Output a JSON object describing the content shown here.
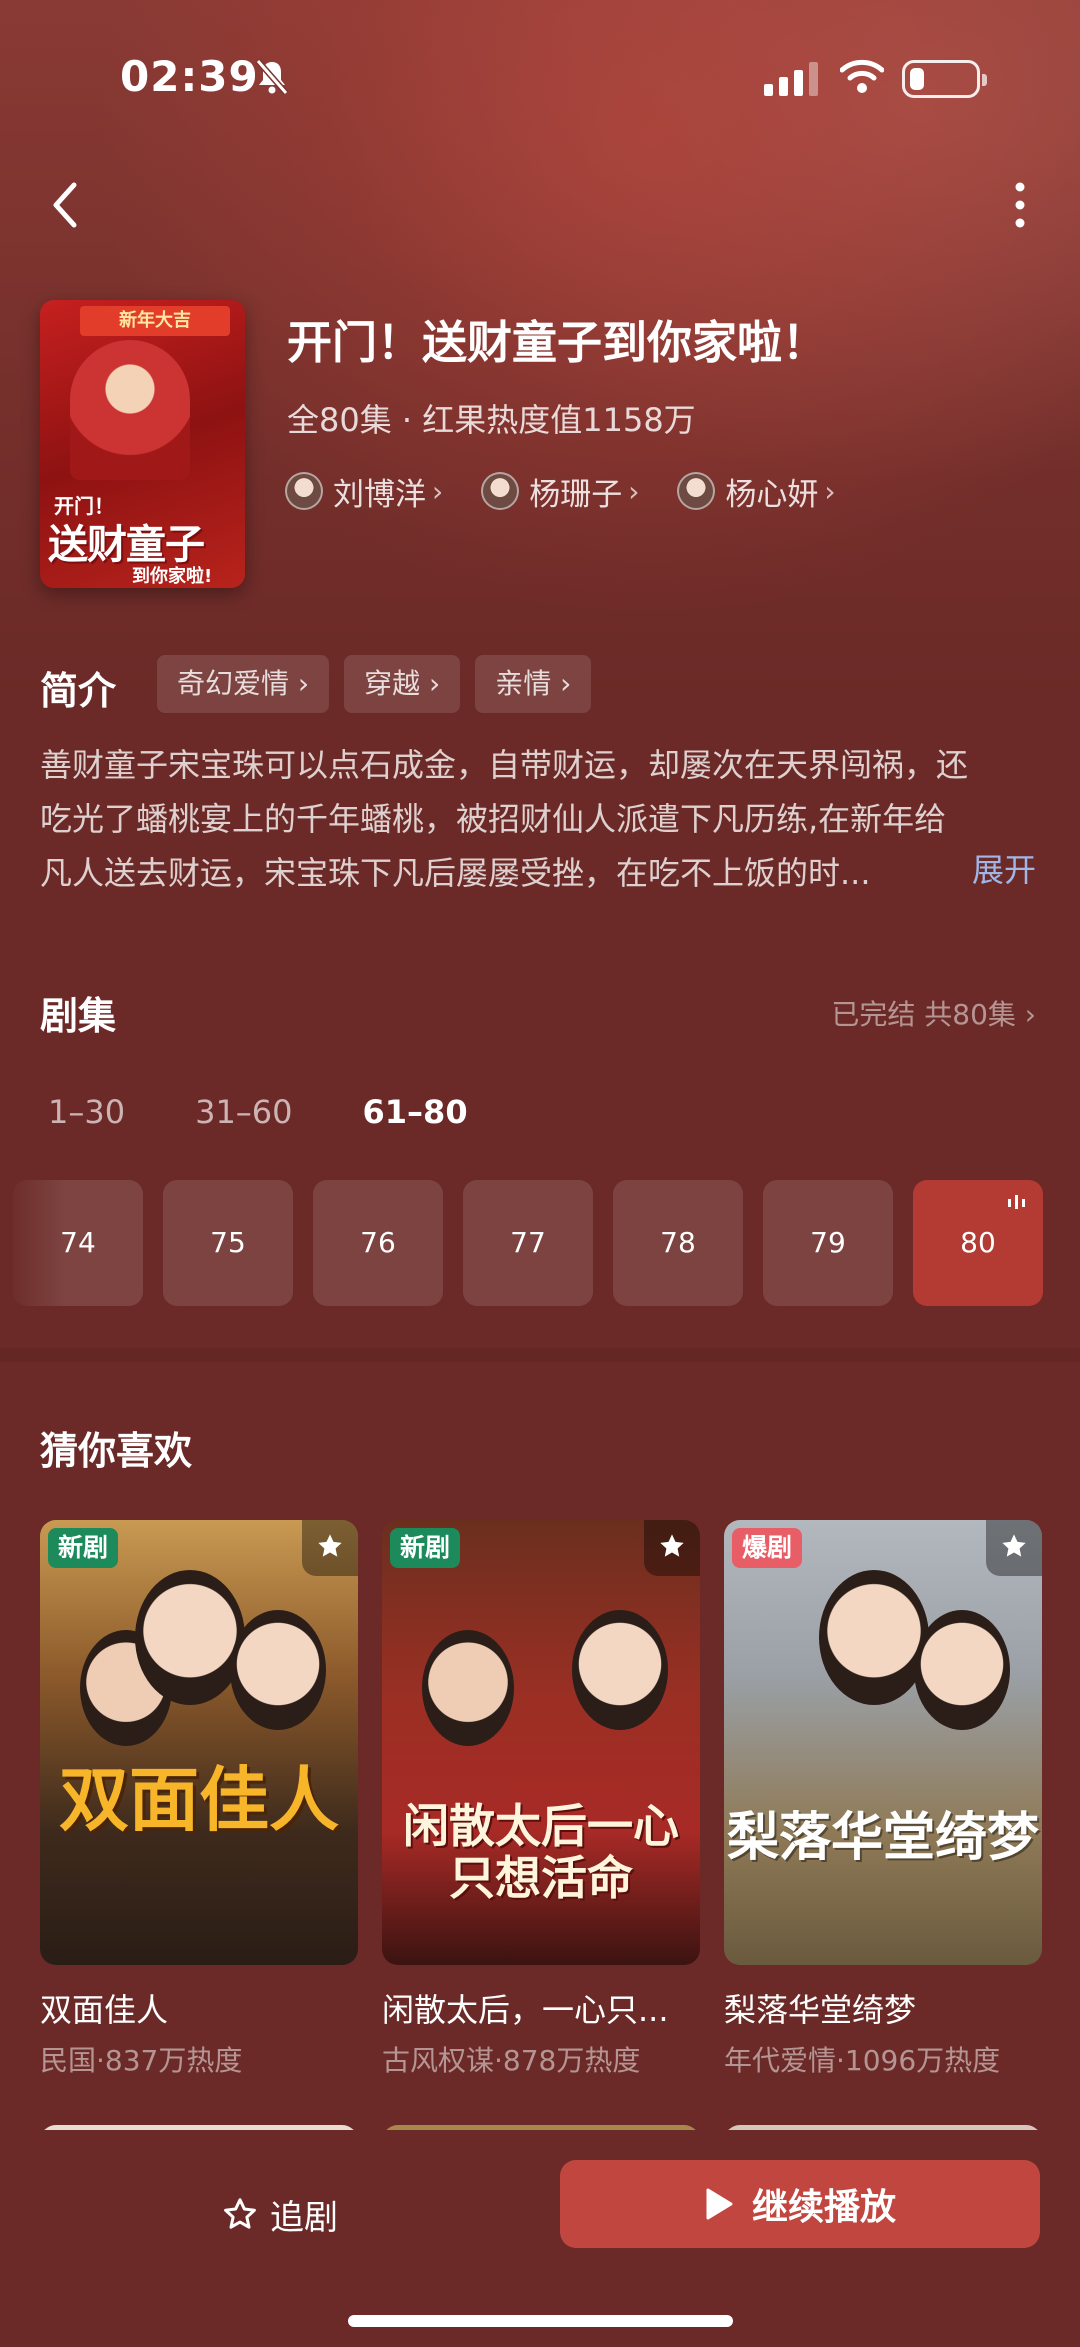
{
  "status_bar": {
    "time": "02:39"
  },
  "show": {
    "title": "开门！送财童子到你家啦！",
    "meta": "全80集 · 红果热度值1158万",
    "poster": {
      "banner": "新年大吉",
      "line1": "开门！",
      "line2": "送财童子",
      "line3": "到你家啦!"
    },
    "cast": [
      {
        "name": "刘博洋"
      },
      {
        "name": "杨珊子"
      },
      {
        "name": "杨心妍"
      }
    ]
  },
  "intro": {
    "heading": "简介",
    "tags": [
      "奇幻爱情",
      "穿越",
      "亲情"
    ],
    "lines": [
      "善财童子宋宝珠可以点石成金，自带财运，却屡次在天界闯祸，还",
      "吃光了蟠桃宴上的千年蟠桃，被招财仙人派遣下凡历练,在新年给",
      "凡人送去财运，宋宝珠下凡后屡屡受挫，在吃不上饭的时..."
    ],
    "expand": "展开"
  },
  "episodes": {
    "heading": "剧集",
    "status": "已完结 共80集",
    "ranges": [
      "1–30",
      "31–60",
      "61–80"
    ],
    "active_range": 2,
    "items": [
      "74",
      "75",
      "76",
      "77",
      "78",
      "79",
      "80"
    ],
    "playing": "80"
  },
  "recommend": {
    "heading": "猜你喜欢",
    "items": [
      {
        "title": "双面佳人",
        "sub": "民国·837万热度",
        "badge": "新剧",
        "badge_type": "new",
        "art": "双面佳人"
      },
      {
        "title": "闲散太后，一心只...",
        "sub": "古风权谋·878万热度",
        "badge": "新剧",
        "badge_type": "new",
        "art": "闲散太后一心只想活命"
      },
      {
        "title": "梨落华堂绮梦",
        "sub": "年代爱情·1096万热度",
        "badge": "爆剧",
        "badge_type": "hot",
        "art": "梨落华堂绮梦"
      }
    ]
  },
  "bottom": {
    "follow": "追剧",
    "play": "继续播放"
  },
  "colors": {
    "background": "#6b2a27",
    "accent": "#c1463f",
    "link": "#9fb6e6",
    "badge_new": "#1d8a5c",
    "badge_hot": "#e85e66"
  }
}
